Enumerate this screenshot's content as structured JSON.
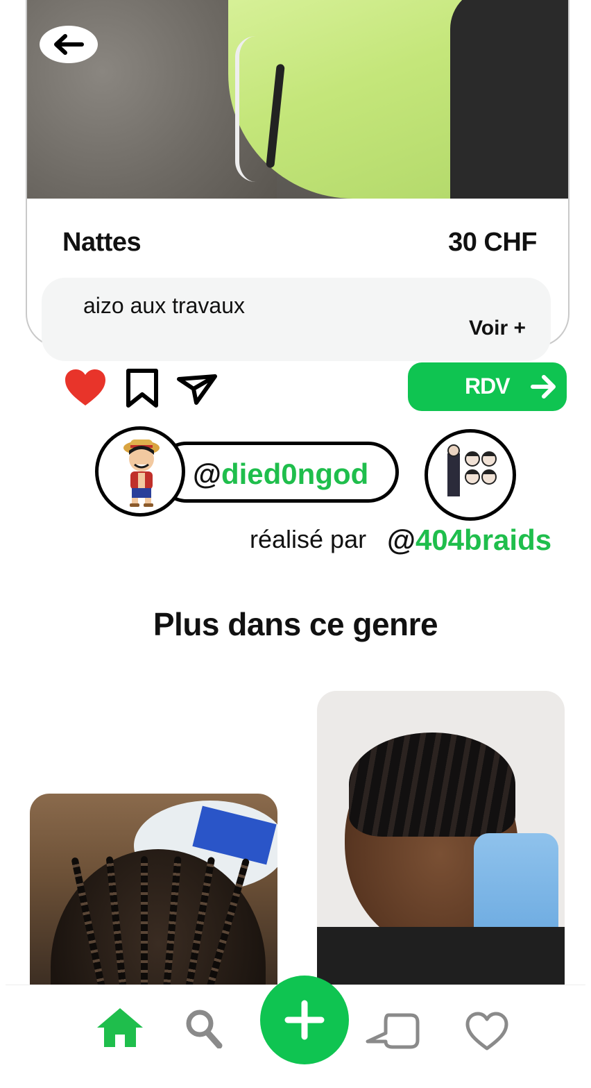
{
  "post": {
    "title": "Nattes",
    "price": "30 CHF",
    "description": "aizo aux travaux",
    "see_more": "Voir +"
  },
  "actions": {
    "book_label": "RDV",
    "liked": true
  },
  "author": {
    "at": "@",
    "handle": "died0ngod"
  },
  "credit": {
    "prefix": "réalisé par",
    "at": "@",
    "handle": "404braids"
  },
  "section": {
    "title": "Plus dans ce genre"
  },
  "colors": {
    "accent": "#0fc451",
    "like": "#e8342a"
  },
  "icons": {
    "back": "arrow-left-icon",
    "like": "heart-icon",
    "save": "bookmark-icon",
    "share": "paper-plane-icon",
    "home": "home-icon",
    "search": "search-icon",
    "add": "plus-icon",
    "chat": "chat-bubble-icon",
    "likes": "heart-outline-icon"
  }
}
